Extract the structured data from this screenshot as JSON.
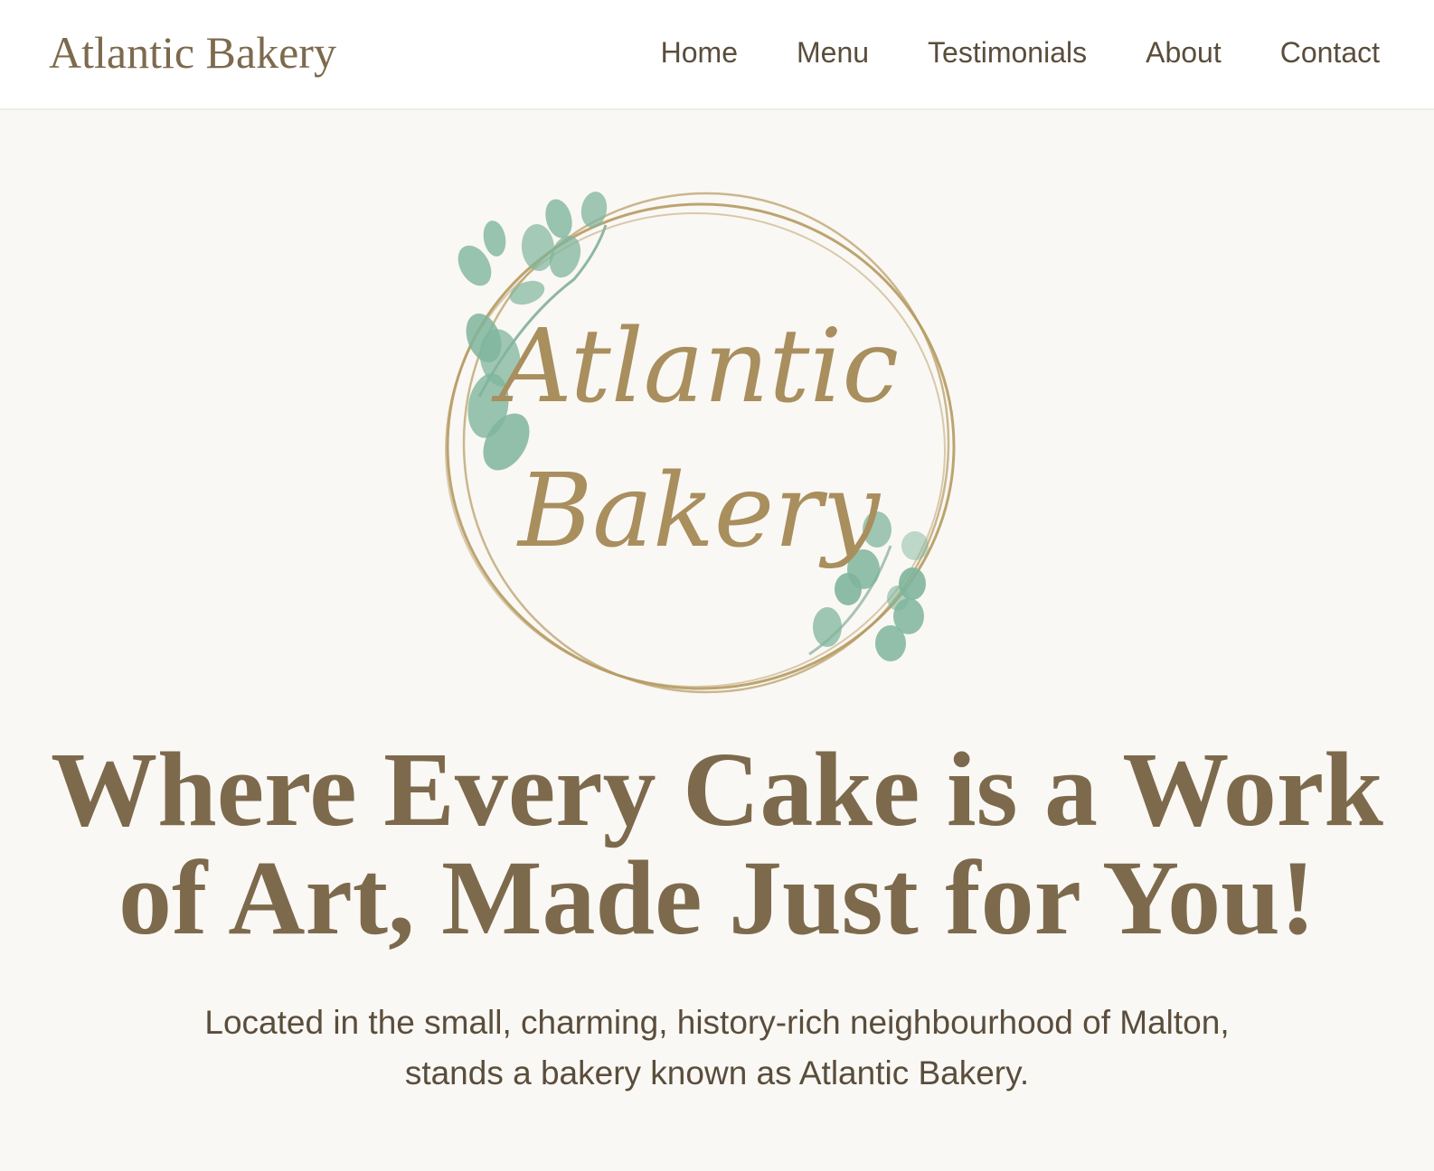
{
  "header": {
    "brand": "Atlantic Bakery",
    "nav": [
      {
        "label": "Home"
      },
      {
        "label": "Menu"
      },
      {
        "label": "Testimonials"
      },
      {
        "label": "About"
      },
      {
        "label": "Contact"
      }
    ]
  },
  "hero": {
    "logo": {
      "line1": "Atlantic",
      "line2": "Bakery",
      "ring_color": "#b59a62",
      "leaf_color": "#7fb59c"
    },
    "headline_line1": "Where Every Cake is a Work",
    "headline_line2": "of Art, Made Just for You!",
    "tagline_line1": "Located in the small, charming, history-rich neighbourhood of Malton,",
    "tagline_line2": "stands a bakery known as Atlantic Bakery."
  },
  "colors": {
    "brand": "#7d6a4d",
    "text": "#5a4d3c",
    "background": "#faf8f4",
    "header_background": "#ffffff"
  }
}
